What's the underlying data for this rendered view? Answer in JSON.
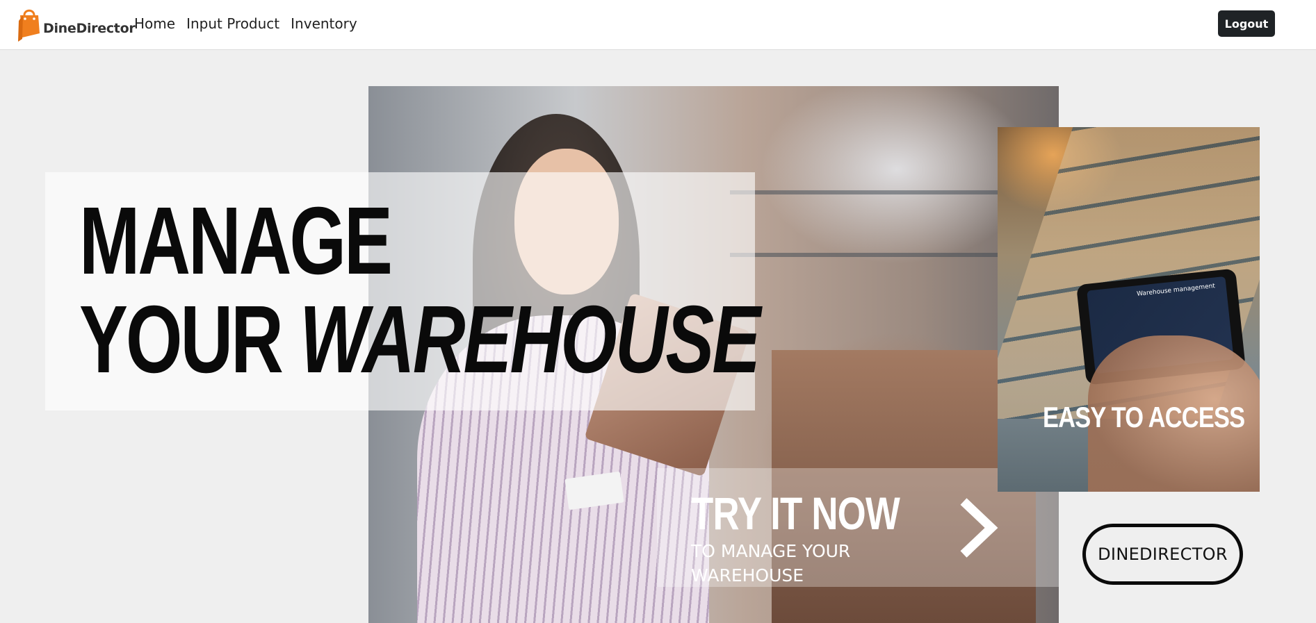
{
  "navbar": {
    "brand_name": "DineDirector",
    "logo_icon": "shopping-bag-icon",
    "links": [
      "Home",
      "Input Product",
      "Inventory"
    ],
    "logout_label": "Logout"
  },
  "hero": {
    "headline_line1": "MANAGE",
    "headline_line2_plain": "YOUR",
    "headline_line2_italic": "WAREHOUSE"
  },
  "cta": {
    "title": "TRY IT NOW",
    "subtitle": "TO MANAGE YOUR WAREHOUSE",
    "arrow_icon": "chevron-right-icon"
  },
  "side_panel": {
    "caption": "EASY TO ACCESS",
    "tablet_screen_title": "Warehouse management"
  },
  "brand_pill": "DINEDIRECTOR",
  "colors": {
    "accent_orange": "#f07f1e",
    "page_background": "#efefef",
    "logout_button": "#1f2326"
  }
}
